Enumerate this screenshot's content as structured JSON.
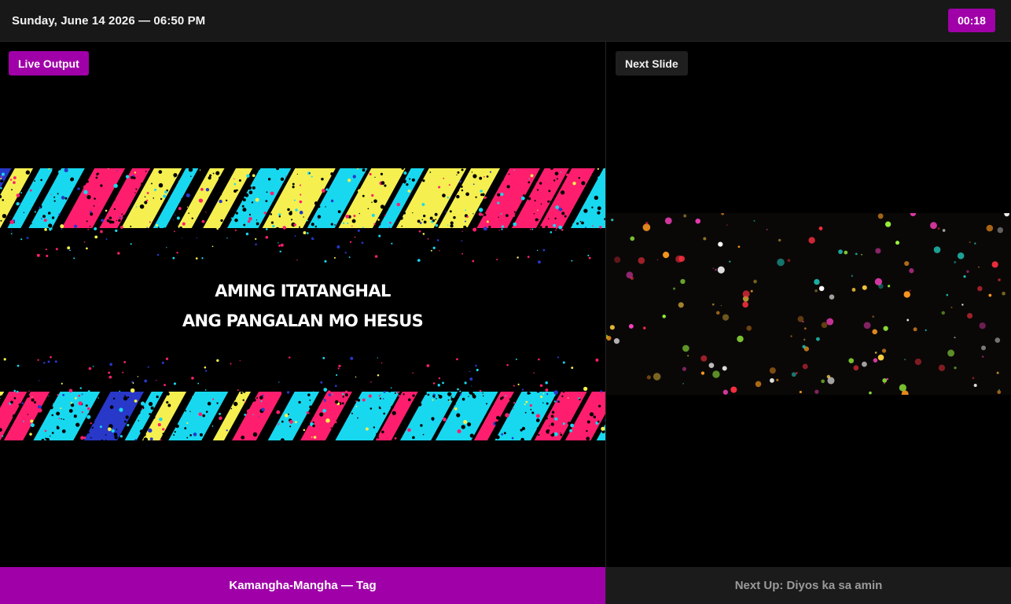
{
  "header": {
    "datetime": "Sunday, June 14 2026 — 06:50 PM",
    "timer": "00:18"
  },
  "live": {
    "label": "Live Output",
    "lyrics": [
      "AMING ITATANGHAL",
      "ANG PANGALAN MO HESUS"
    ],
    "background": "neon-diagonal-stripes-graphic"
  },
  "next": {
    "label": "Next Slide",
    "background": "dark-bokeh-particles-graphic"
  },
  "footer": {
    "current": "Kamangha-Mangha — Tag",
    "next_up": "Next Up: Diyos ka sa amin"
  },
  "colors": {
    "accent": "#a000a8",
    "stripe_pink": "#ff1e6e",
    "stripe_cyan": "#18d8f0",
    "stripe_yellow": "#f5f050",
    "stripe_blue": "#2838c8"
  }
}
